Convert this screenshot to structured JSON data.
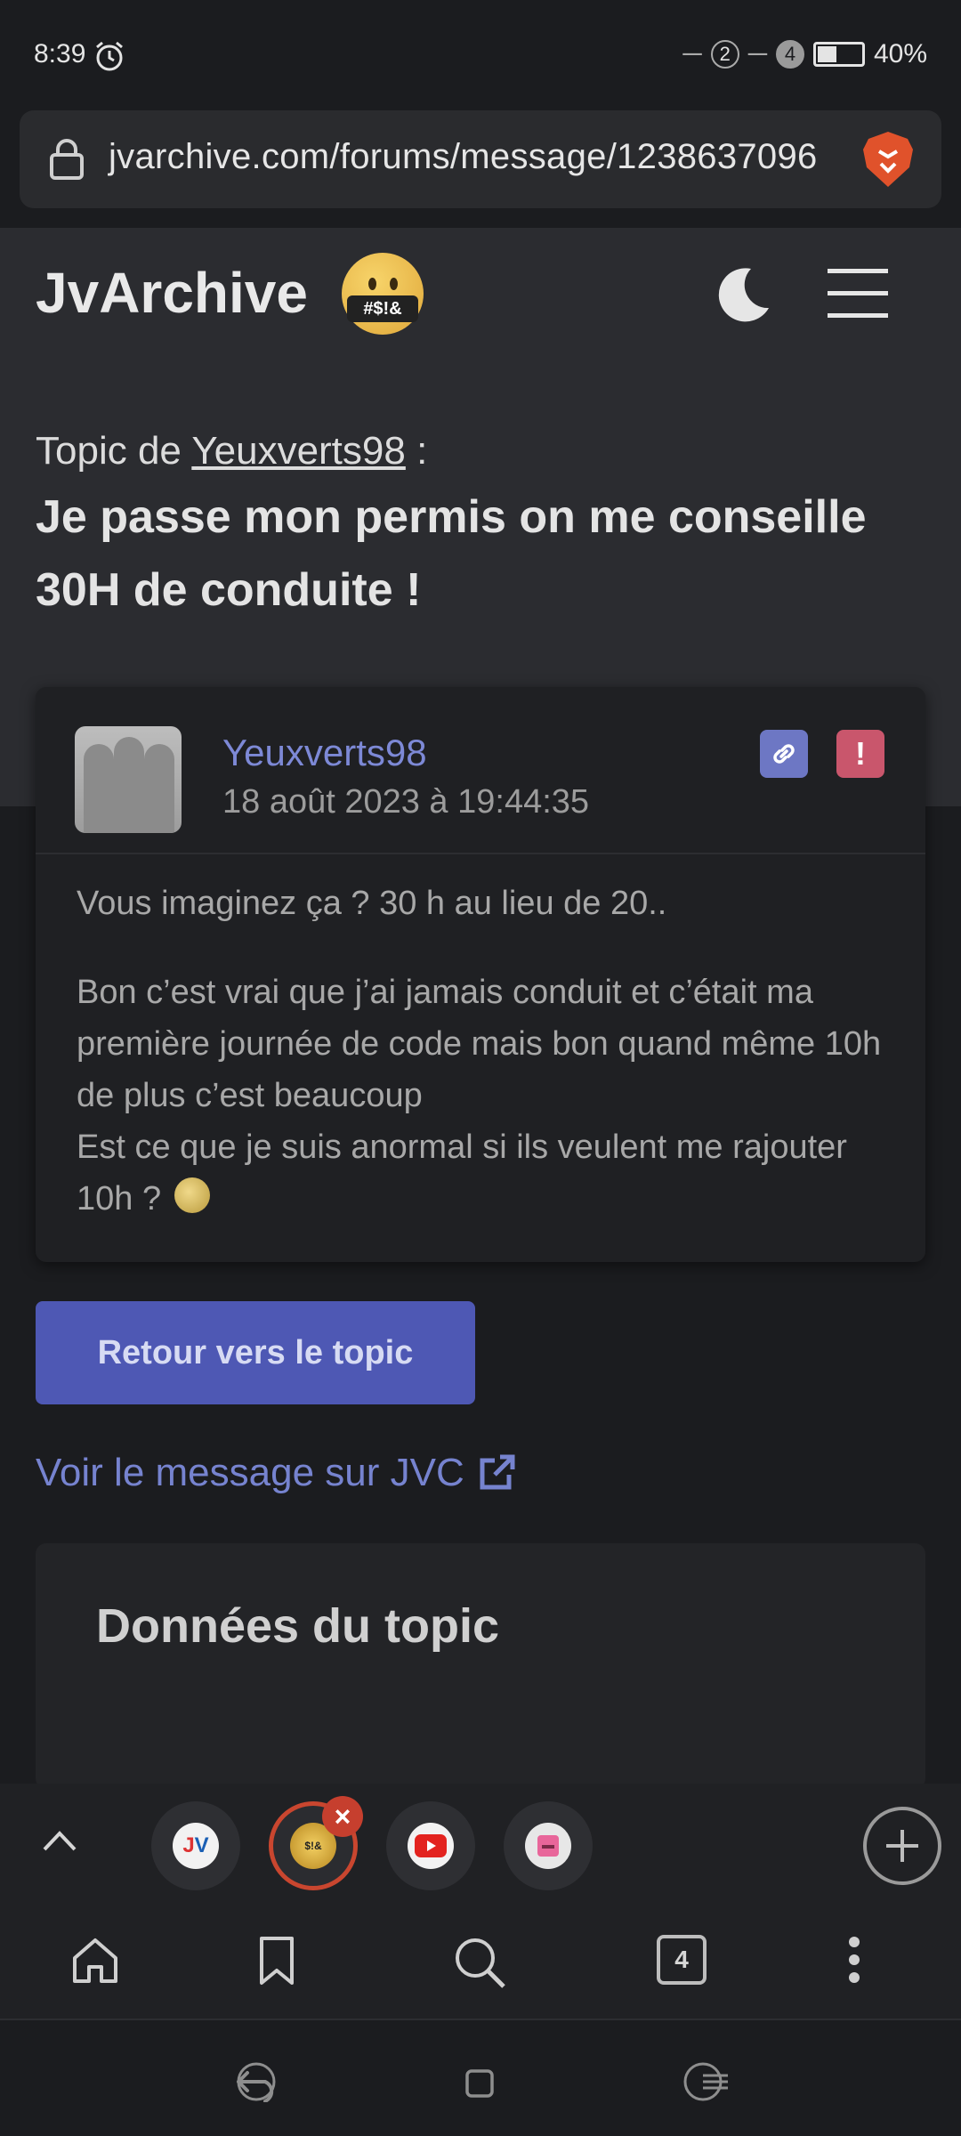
{
  "status": {
    "time": "8:39",
    "sim1": "2",
    "sim2": "4",
    "battery": "40%"
  },
  "browser": {
    "url": "jvarchive.com/forums/message/1238637096"
  },
  "header": {
    "brand": "JvArchive",
    "emoji_text": "#$!&"
  },
  "topic": {
    "prefix": "Topic de ",
    "author": "Yeuxverts98",
    "suffix": " :",
    "title": "Je passe mon permis on me conseille 30H de conduite !"
  },
  "message": {
    "author": "Yeuxverts98",
    "date": "18 août 2023 à 19:44:35",
    "paragraph1": "Vous imaginez ça ? 30 h au lieu de 20..",
    "paragraph2_line1": "Bon c’est vrai que j’ai jamais conduit et c’était ma première journée de code mais bon quand même 10h de plus c’est beaucoup",
    "paragraph2_line2": "Est ce que je suis anormal si ils veulent me rajouter 10h ?"
  },
  "actions": {
    "back_label": "Retour vers le topic",
    "jvc_link": "Voir le message sur JVC"
  },
  "topic_data": {
    "title": "Données du topic"
  },
  "tabs": {
    "count": "4",
    "active_tab_label": "$!&"
  },
  "colors": {
    "accent": "#4e58b4",
    "link": "#7683cf",
    "report": "#c9566c",
    "active_tab": "#c9462f"
  }
}
